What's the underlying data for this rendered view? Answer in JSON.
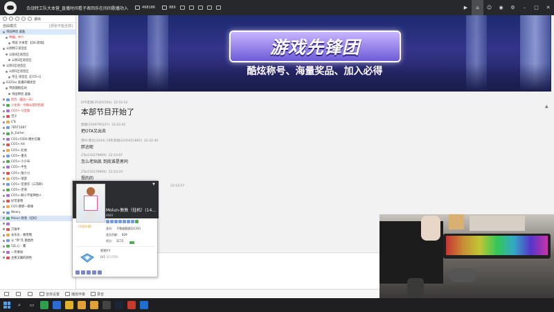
{
  "topbar": {
    "title": "合战特工队大本营_直播时间看子表回乐在间间歌播功入",
    "viewers": "468186",
    "fans": "889",
    "right_buttons": [
      "record-icon",
      "home-icon",
      "people-icon",
      "gamepad-icon",
      "gear-icon",
      "minimize-icon",
      "maximize-icon",
      "close-icon"
    ]
  },
  "left_panel": {
    "toolbar_label": "退出",
    "mode_label": "自由模式",
    "mode_right": "[舒张不能全部]",
    "rows": [
      {
        "text": "帝国神话 戚备",
        "style": "sel"
      },
      {
        "text": "神器，中介",
        "style": "red"
      },
      {
        "text": "帝国 大本营 【QS-游戏】",
        "style": ""
      },
      {
        "text": "公频特工语音区",
        "style": ""
      },
      {
        "text": "公频4区语音区",
        "style": ""
      },
      {
        "text": "公频3区语音区",
        "style": ""
      },
      {
        "text": "公频2区语音区",
        "style": ""
      },
      {
        "text": "公频1区语音区",
        "style": ""
      },
      {
        "text": "帝王 语音区【CO5+】",
        "style": ""
      },
      {
        "text": "6325ss 直播开播语音",
        "style": ""
      },
      {
        "text": "帝国面板挂站",
        "style": ""
      },
      {
        "text": "帝国神话 戚备",
        "style": ""
      },
      {
        "text": "阿苏（最近一天）",
        "style": "red"
      },
      {
        "text": "少女男：今晚从南到西爱",
        "style": "red"
      },
      {
        "text": "CO5+-马里奥",
        "style": "red"
      },
      {
        "text": "浮夕",
        "style": ""
      },
      {
        "text": "CTs",
        "style": ""
      },
      {
        "text": "7B5T1087",
        "style": ""
      },
      {
        "text": "Jk_Earter",
        "style": ""
      },
      {
        "text": "CO5+5500 偶尔沉睡",
        "style": ""
      },
      {
        "text": "CO5+-XX",
        "style": ""
      },
      {
        "text": "CO5+-北地",
        "style": ""
      },
      {
        "text": "CO5+-重天",
        "style": ""
      },
      {
        "text": "CO5+-小小布",
        "style": ""
      },
      {
        "text": "CO5+-半生",
        "style": ""
      },
      {
        "text": "CO5+-敖小小",
        "style": ""
      },
      {
        "text": "CO5+-瑞游",
        "style": ""
      },
      {
        "text": "CO5+-堂渡华（三哥郎)",
        "style": ""
      },
      {
        "text": "CO5+-老罪",
        "style": ""
      },
      {
        "text": "CO5+-鲜小不留神他人",
        "style": ""
      },
      {
        "text": "好可爱哦",
        "style": ""
      },
      {
        "text": "CO5-朗郭一朗湖",
        "style": ""
      },
      {
        "text": "Weary",
        "style": ""
      },
      {
        "text": "Molun-敦敦（挂机）",
        "style": "sel"
      },
      {
        "text": "",
        "style": ""
      },
      {
        "text": "刀锋手",
        "style": ""
      },
      {
        "text": "长乐乐 - 春卷哦",
        "style": ""
      },
      {
        "text": "公 \"帝\"凡 猿类吹",
        "style": ""
      },
      {
        "text": "5兵 心 -  赢",
        "style": ""
      },
      {
        "text": "一笑要闹",
        "style": ""
      },
      {
        "text": "主要又确的颜色",
        "style": ""
      }
    ]
  },
  "banner": {
    "title": "游戏先锋团",
    "subtitle": "酷炫称号、海量奖品、加入必得"
  },
  "chat": {
    "messages": [
      {
        "nick": "CPS老敦(35201504)",
        "time": "22:22:32",
        "text": "本部节目开始了",
        "big": true
      },
      {
        "nick": "智腿(2549795337)",
        "time": "22:22:42",
        "text": "把OTA又出去",
        "big": false
      },
      {
        "nick": "澳FA 斯比(2244) 10年老胡(2245451862)",
        "time": "22:22:49",
        "text": "胖达呢",
        "big": false
      },
      {
        "nick": "2Ta(154278909)",
        "time": "22:23:07",
        "text": "怎么老贴凯 到底谁是男同",
        "big": false
      },
      {
        "nick": "2Ta(154278909)",
        "time": "22:23:10",
        "text": "授的的",
        "big": false
      },
      {
        "nick": "",
        "time": "22:23:27",
        "text": "",
        "big": false
      }
    ]
  },
  "popup": {
    "name": "Molun-敦敦（挂机）(14...",
    "id": "4683",
    "tag": "[内容未填]",
    "role_label": "身份：",
    "role_value": "子频道管理员(CA2)",
    "contrib_label": "会员贡献：",
    "contrib_value": "829",
    "points_label": "积分：",
    "points_value": "2173",
    "rank": "初始YY",
    "level": "LV1",
    "level_progress": "(0/1700)"
  },
  "roombar": {
    "items": [
      "音效设置",
      "播放伴奏",
      "录音"
    ]
  },
  "colors": {
    "accent": "#4aa3ff",
    "red_text": "#d33333",
    "banner_top": "#1d2a70"
  }
}
